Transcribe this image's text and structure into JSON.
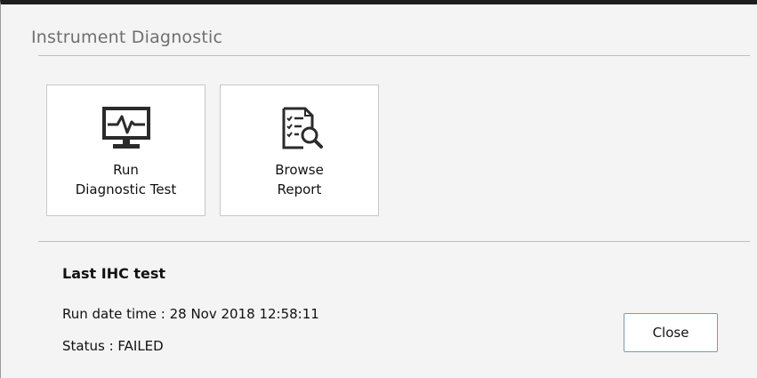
{
  "dialog": {
    "title": "Instrument Diagnostic"
  },
  "tiles": [
    {
      "icon": "monitor-pulse-icon",
      "label_line1": "Run",
      "label_line2": "Diagnostic Test"
    },
    {
      "icon": "report-search-icon",
      "label_line1": "Browse",
      "label_line2": "Report"
    }
  ],
  "last_test": {
    "heading": "Last IHC test",
    "run_date_time": "Run date time : 28 Nov 2018 12:58:11",
    "status": "Status : FAILED"
  },
  "buttons": {
    "close_label": "Close"
  },
  "colors": {
    "window_bg": "#f4f4f4",
    "tile_bg": "#ffffff",
    "icon_color": "#2b2b2b",
    "title_text": "#6f6f6f",
    "button_border": "#7a99b8"
  }
}
